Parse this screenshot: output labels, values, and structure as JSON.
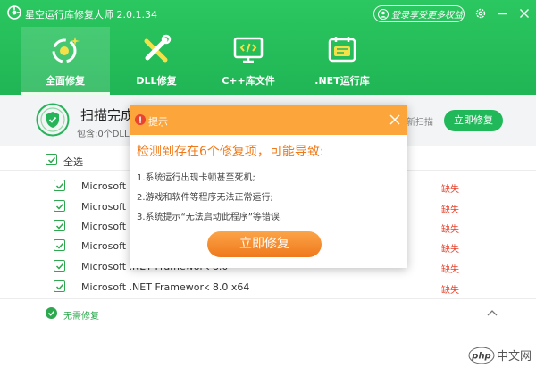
{
  "app": {
    "title": "星空运行库修复大师 2.0.1.34",
    "login_label": "登录享受更多权益"
  },
  "nav": {
    "items": [
      {
        "label": "全面修复",
        "active": true
      },
      {
        "label": "DLL修复",
        "active": false
      },
      {
        "label": "C++库文件",
        "active": false
      },
      {
        "label": ".NET运行库",
        "active": false
      }
    ]
  },
  "scan": {
    "title": "扫描完成",
    "subtitle": "包含:0个DLL缺",
    "rescan_label": "新扫描",
    "fix_label": "立即修复"
  },
  "list": {
    "select_all_label": "全选",
    "items": [
      {
        "name": "Microsoft .N",
        "status": "缺失"
      },
      {
        "name": "Microsoft .N",
        "status": "缺失"
      },
      {
        "name": "Microsoft .N",
        "status": "缺失"
      },
      {
        "name": "Microsoft .N",
        "status": "缺失"
      },
      {
        "name": "Microsoft .NET Framework 8.0",
        "status": "缺失"
      },
      {
        "name": "Microsoft .NET Framework 8.0 x64",
        "status": "缺失"
      }
    ],
    "no_fix_label": "无需修复"
  },
  "popup": {
    "header_title": "提示",
    "headline": "检测到存在6个修复项，可能导致:",
    "reasons": [
      "1.系统运行出现卡顿甚至死机;",
      "2.游戏和软件等程序无法正常运行;",
      "3.系统提示“无法启动此程序”等错误."
    ],
    "button_label": "立即修复"
  },
  "watermark": "php 中文网",
  "colors": {
    "brand_green": "#22b858",
    "accent_orange": "#f58a2a",
    "error_red": "#e8442e"
  }
}
